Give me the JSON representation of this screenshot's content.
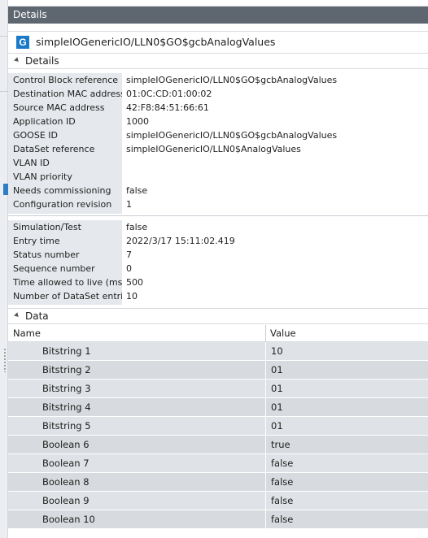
{
  "window": {
    "title": "Details"
  },
  "header": {
    "icon_letter": "G",
    "title": "simpleIOGenericIO/LLN0$GO$gcbAnalogValues"
  },
  "details_section": {
    "label": "Details"
  },
  "details_group1": [
    {
      "label": "Control Block reference",
      "value": "simpleIOGenericIO/LLN0$GO$gcbAnalogValues"
    },
    {
      "label": "Destination MAC address",
      "value": "01:0C:CD:01:00:02"
    },
    {
      "label": "Source MAC address",
      "value": "42:F8:84:51:66:61"
    },
    {
      "label": "Application ID",
      "value": "1000"
    },
    {
      "label": "GOOSE ID",
      "value": "simpleIOGenericIO/LLN0$GO$gcbAnalogValues"
    },
    {
      "label": "DataSet reference",
      "value": "simpleIOGenericIO/LLN0$AnalogValues"
    },
    {
      "label": "VLAN ID",
      "value": ""
    },
    {
      "label": "VLAN priority",
      "value": ""
    },
    {
      "label": "Needs commissioning",
      "value": "false"
    },
    {
      "label": "Configuration revision",
      "value": "1"
    }
  ],
  "details_group2": [
    {
      "label": "Simulation/Test",
      "value": "false"
    },
    {
      "label": "Entry time",
      "value": "2022/3/17 15:11:02.419"
    },
    {
      "label": "Status number",
      "value": "7"
    },
    {
      "label": "Sequence number",
      "value": "0"
    },
    {
      "label": "Time allowed to live (ms)",
      "value": "500"
    },
    {
      "label": "Number of DataSet entries",
      "value": "10"
    }
  ],
  "data_section": {
    "label": "Data"
  },
  "data_grid": {
    "columns": {
      "name": "Name",
      "value": "Value"
    },
    "rows": [
      {
        "name": "Bitstring 1",
        "value": "10"
      },
      {
        "name": "Bitstring 2",
        "value": "01"
      },
      {
        "name": "Bitstring 3",
        "value": "01"
      },
      {
        "name": "Bitstring 4",
        "value": "01"
      },
      {
        "name": "Bitstring 5",
        "value": "01"
      },
      {
        "name": "Boolean 6",
        "value": "true"
      },
      {
        "name": "Boolean 7",
        "value": "false"
      },
      {
        "name": "Boolean 8",
        "value": "false"
      },
      {
        "name": "Boolean 9",
        "value": "false"
      },
      {
        "name": "Boolean 10",
        "value": "false"
      }
    ]
  },
  "colors": {
    "title_bar": "#5e6670",
    "icon": "#1a79c8",
    "label_column": "#e5e8ec",
    "grid_row": "#dfe2e6"
  }
}
